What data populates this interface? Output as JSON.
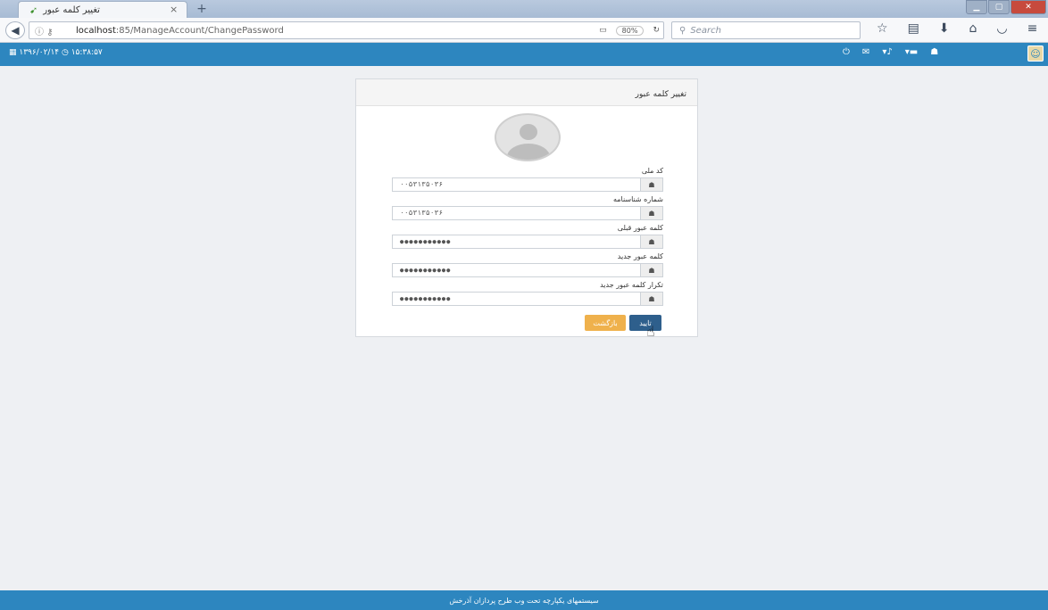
{
  "browser": {
    "tab_title": "تغییر کلمه عبور",
    "tab_close": "×",
    "new_tab": "+",
    "url_host": "localhost",
    "url_path": ":85/ManageAccount/ChangePassword",
    "zoom": "80%",
    "search_placeholder": "Search"
  },
  "app_header": {
    "datetime": "۱۳۹۶/۰۲/۱۴ ◷ ۱۵:۳۸:۵۷"
  },
  "panel": {
    "title": "تغییر کلمه عبور",
    "fields": [
      {
        "label": "کد ملی",
        "value": "۰۰۵۳۱۳۵۰۳۶"
      },
      {
        "label": "شماره شناسنامه",
        "value": "۰۰۵۳۱۳۵۰۳۶"
      },
      {
        "label": "کلمه عبور قبلی",
        "value": "●●●●●●●●●●●"
      },
      {
        "label": "کلمه عبور جدید",
        "value": "●●●●●●●●●●●"
      },
      {
        "label": "تکرار کلمه عبور جدید",
        "value": "●●●●●●●●●●●"
      }
    ],
    "confirm_label": "تایید",
    "back_label": "بازگشت"
  },
  "footer": {
    "text": "سیستمهای یکپارچه تحت وب طرح پردازان آذرخش"
  },
  "colors": {
    "header_blue": "#2d86bf",
    "confirm_button": "#2e5f8c",
    "back_button": "#efb14c"
  },
  "icons": [
    "back-arrow-icon",
    "info-icon",
    "key-icon",
    "reader-icon",
    "reload-icon",
    "search-icon",
    "bookmark-star-icon",
    "clipboard-icon",
    "download-icon",
    "home-icon",
    "pocket-icon",
    "menu-icon",
    "calendar-icon",
    "clock-icon",
    "power-icon",
    "mail-icon",
    "bell-icon",
    "user-icon",
    "hand-cursor-icon"
  ]
}
